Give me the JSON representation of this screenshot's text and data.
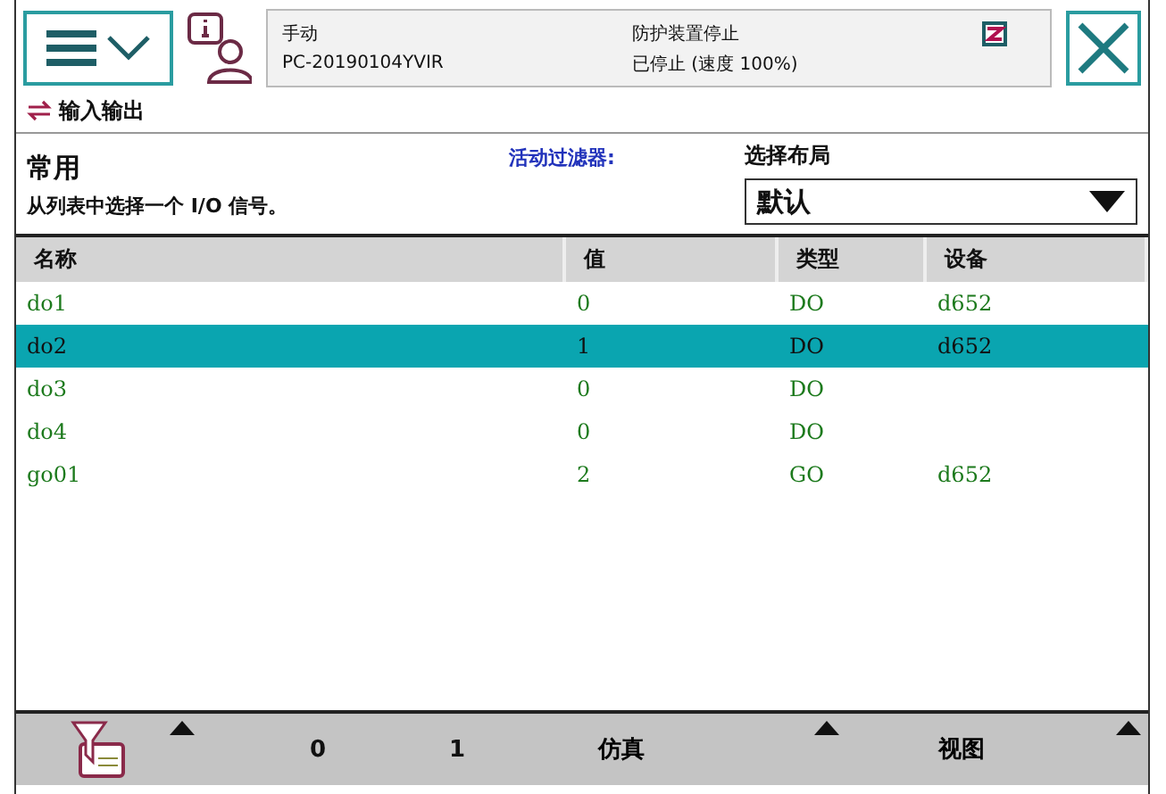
{
  "status": {
    "mode": "手动",
    "controller": "PC-20190104YVIR",
    "safety": "防护装置停止",
    "state": "已停止 (速度 100%)"
  },
  "window": {
    "title": "输入输出"
  },
  "filter": {
    "category": "常用",
    "instruction": "从列表中选择一个 I/O 信号。",
    "active_filter_label": "活动过滤器:",
    "layout_label": "选择布局",
    "layout_value": "默认"
  },
  "table": {
    "columns": [
      "名称",
      "值",
      "类型",
      "设备"
    ],
    "rows": [
      {
        "cells": [
          "do1",
          "0",
          "DO",
          "d652"
        ],
        "selected": false
      },
      {
        "cells": [
          "do2",
          "1",
          "DO",
          "d652"
        ],
        "selected": true
      },
      {
        "cells": [
          "do3",
          "0",
          "DO",
          ""
        ],
        "selected": false
      },
      {
        "cells": [
          "do4",
          "0",
          "DO",
          ""
        ],
        "selected": false
      },
      {
        "cells": [
          "go01",
          "2",
          "GO",
          "d652"
        ],
        "selected": false
      }
    ]
  },
  "toolbar": {
    "items": [
      {
        "kind": "filter"
      },
      {
        "kind": "value",
        "label": "0"
      },
      {
        "kind": "value",
        "label": "1"
      },
      {
        "kind": "menu",
        "label": "仿真"
      },
      {
        "kind": "menu",
        "label": "视图"
      }
    ]
  }
}
